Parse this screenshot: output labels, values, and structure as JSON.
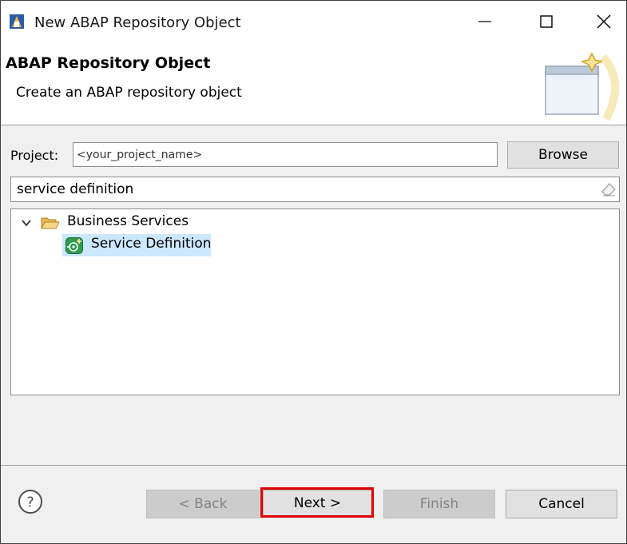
{
  "window": {
    "title": "New ABAP Repository Object"
  },
  "banner": {
    "title": "ABAP Repository Object",
    "subtitle": "Create an ABAP repository object"
  },
  "project": {
    "label": "Project:",
    "value": "<your_project_name>",
    "browse_label": "Browse"
  },
  "filter": {
    "value": "service definition"
  },
  "tree": {
    "parent": {
      "label": "Business Services",
      "expanded": true
    },
    "child": {
      "label": "Service Definition",
      "selected": true
    }
  },
  "buttons": {
    "back": "< Back",
    "next": "Next >",
    "finish": "Finish",
    "cancel": "Cancel"
  },
  "colors": {
    "selection": "#cce8ff",
    "highlight": "#e00000",
    "service_icon": "#2e9c4c"
  }
}
